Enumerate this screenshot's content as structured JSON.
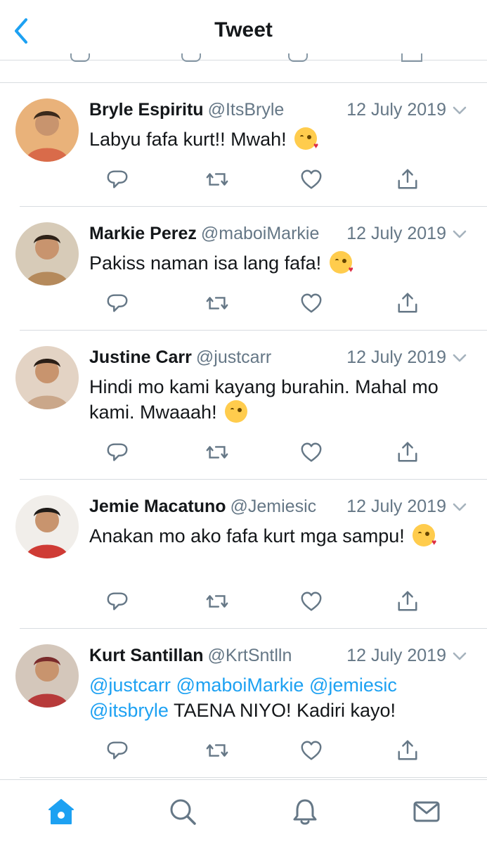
{
  "header": {
    "title": "Tweet",
    "back_icon": "chevron-left-icon"
  },
  "colors": {
    "accent": "#1da1f2",
    "text": "#14171a",
    "secondary": "#657786",
    "divider": "#d8dce0",
    "icon": "#657786"
  },
  "tweets": [
    {
      "name": "Bryle Espiritu",
      "handle": "@ItsBryle",
      "date": "12 July 2019",
      "text_parts": [
        {
          "text": "Labyu fafa kurt!! Mwah!",
          "mention": false
        }
      ],
      "emoji": "kiss-emoji"
    },
    {
      "name": "Markie Perez",
      "handle": "@maboiMarkie",
      "date": "12 July 2019",
      "text_parts": [
        {
          "text": "Pakiss naman isa lang fafa!",
          "mention": false
        }
      ],
      "emoji": "kiss-emoji"
    },
    {
      "name": "Justine Carr",
      "handle": "@justcarr",
      "date": "12 July 2019",
      "text_parts": [
        {
          "text": "Hindi mo kami kayang burahin. Mahal mo kami. Mwaaah!",
          "mention": false
        }
      ],
      "emoji": "yum-emoji"
    },
    {
      "name": "Jemie Macatuno",
      "handle": "@Jemiesic",
      "date": "12 July 2019",
      "text_parts": [
        {
          "text": "Anakan mo ako fafa kurt mga sampu!",
          "mention": false
        }
      ],
      "emoji": "kiss-emoji"
    },
    {
      "name": "Kurt Santillan",
      "handle": "@KrtSntlln",
      "date": "12 July 2019",
      "text_parts": [
        {
          "text": "@justcarr",
          "mention": true
        },
        {
          "text": " ",
          "mention": false
        },
        {
          "text": "@maboiMarkie",
          "mention": true
        },
        {
          "text": " ",
          "mention": false
        },
        {
          "text": "@jemiesic",
          "mention": true
        },
        {
          "text": " ",
          "mention": false
        },
        {
          "text": "@itsbryle",
          "mention": true
        },
        {
          "text": " TAENA NIYO! Kadiri kayo!",
          "mention": false
        }
      ],
      "emoji": ""
    }
  ],
  "tabbar": {
    "items": [
      {
        "name": "home",
        "icon": "home-icon",
        "active": true
      },
      {
        "name": "search",
        "icon": "search-icon",
        "active": false
      },
      {
        "name": "notifications",
        "icon": "bell-icon",
        "active": false
      },
      {
        "name": "messages",
        "icon": "mail-icon",
        "active": false
      }
    ]
  }
}
